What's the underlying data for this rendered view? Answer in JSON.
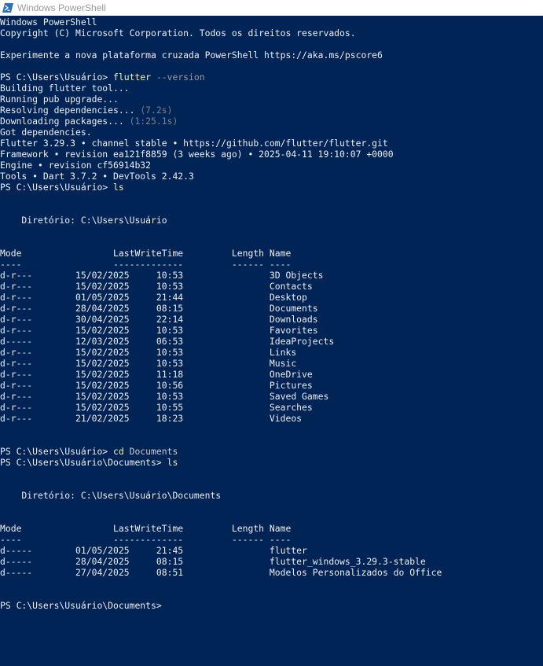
{
  "window": {
    "title": "Windows PowerShell",
    "icon": "powershell-icon",
    "background": "#012456"
  },
  "console": {
    "header": {
      "app": "Windows PowerShell",
      "copyright": "Copyright (C) Microsoft Corporation. Todos os direitos reservados.",
      "promo": "Experimente a nova plataforma cruzada PowerShell https://aka.ms/pscore6"
    },
    "flutter": {
      "prompt": "PS C:\\Users\\Usuário> ",
      "command": "flutter",
      "param": " --version",
      "out1": "Building flutter tool...",
      "out2": "Running pub upgrade...",
      "out3_text": "Resolving dependencies... ",
      "out3_time": "(7.2s)",
      "out4_text": "Downloading packages... ",
      "out4_time": "(1:25.1s)",
      "out5": "Got dependencies.",
      "out6": "Flutter 3.29.3 • channel stable • https://github.com/flutter/flutter.git",
      "out7": "Framework • revision ea121f8859 (3 weeks ago) • 2025-04-11 19:10:07 +0000",
      "out8": "Engine • revision cf56914b32",
      "out9": "Tools • Dart 3.7.2 • DevTools 2.42.3"
    },
    "ls1": {
      "prompt": "PS C:\\Users\\Usuário> ",
      "command": "ls",
      "directory": "    Diretório: C:\\Users\\Usuário",
      "header": "Mode                 LastWriteTime         Length Name",
      "underline": "----                 -------------         ------ ----",
      "rows": [
        "d-r---        15/02/2025     10:53                3D Objects",
        "d-r---        15/02/2025     10:53                Contacts",
        "d-r---        01/05/2025     21:44                Desktop",
        "d-r---        28/04/2025     08:15                Documents",
        "d-r---        30/04/2025     22:14                Downloads",
        "d-r---        15/02/2025     10:53                Favorites",
        "d-----        12/03/2025     06:53                IdeaProjects",
        "d-r---        15/02/2025     10:53                Links",
        "d-r---        15/02/2025     10:53                Music",
        "d-r---        15/02/2025     11:18                OneDrive",
        "d-r---        15/02/2025     10:56                Pictures",
        "d-r---        15/02/2025     10:53                Saved Games",
        "d-r---        15/02/2025     10:55                Searches",
        "d-r---        21/02/2025     18:23                Videos"
      ]
    },
    "cd": {
      "prompt": "PS C:\\Users\\Usuário> ",
      "command": "cd",
      "arg": " Documents"
    },
    "ls2": {
      "prompt": "PS C:\\Users\\Usuário\\Documents> ",
      "command": "ls",
      "directory": "    Diretório: C:\\Users\\Usuário\\Documents",
      "header": "Mode                 LastWriteTime         Length Name",
      "underline": "----                 -------------         ------ ----",
      "rows": [
        "d-----        01/05/2025     21:45                flutter",
        "d-----        28/04/2025     08:15                flutter_windows_3.29.3-stable",
        "d-----        27/04/2025     08:51                Modelos Personalizados do Office"
      ]
    },
    "final_prompt": "PS C:\\Users\\Usuário\\Documents> "
  }
}
